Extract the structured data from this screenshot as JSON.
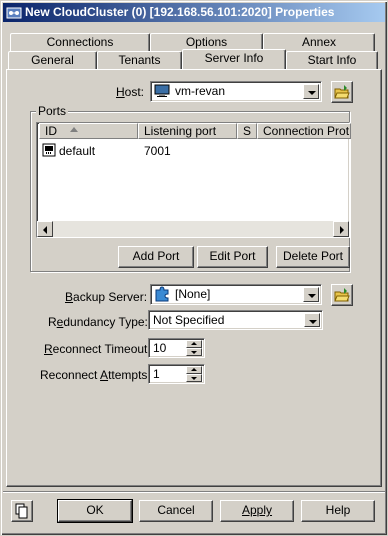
{
  "window": {
    "title": "New CloudCluster (0) [192.168.56.101:2020] Properties"
  },
  "tabs_back": [
    "Connections",
    "Options",
    "Annex"
  ],
  "tabs_front": [
    "General",
    "Tenants",
    "Server Info",
    "Start Info"
  ],
  "active_tab": "Server Info",
  "host": {
    "label": "Host:",
    "value": "vm-revan"
  },
  "ports": {
    "group_label": "Ports",
    "columns": [
      "ID",
      "Listening port",
      "S",
      "Connection Prot..."
    ],
    "rows": [
      {
        "id": "default",
        "port": "7001",
        "s": "",
        "protocol": ""
      }
    ],
    "buttons": {
      "add": "Add Port",
      "edit": "Edit Port",
      "delete": "Delete Port"
    }
  },
  "backup_server": {
    "label": "Backup Server:",
    "value": "[None]"
  },
  "redundancy_type": {
    "label": "Redundancy Type:",
    "value": "Not Specified"
  },
  "reconnect_timeout": {
    "label": "Reconnect Timeout:",
    "value": "10"
  },
  "reconnect_attempts": {
    "label": "Reconnect Attempts:",
    "value": "1"
  },
  "footer": {
    "ok": "OK",
    "cancel": "Cancel",
    "apply": "Apply",
    "help": "Help"
  },
  "colors": {
    "title_start": "#0a246a",
    "title_end": "#a6caf0",
    "face": "#d4d0c8"
  },
  "icons": [
    "cluster-icon",
    "monitor-icon",
    "folder-open-icon",
    "puzzle-icon",
    "server-port-icon",
    "copy-icon"
  ]
}
